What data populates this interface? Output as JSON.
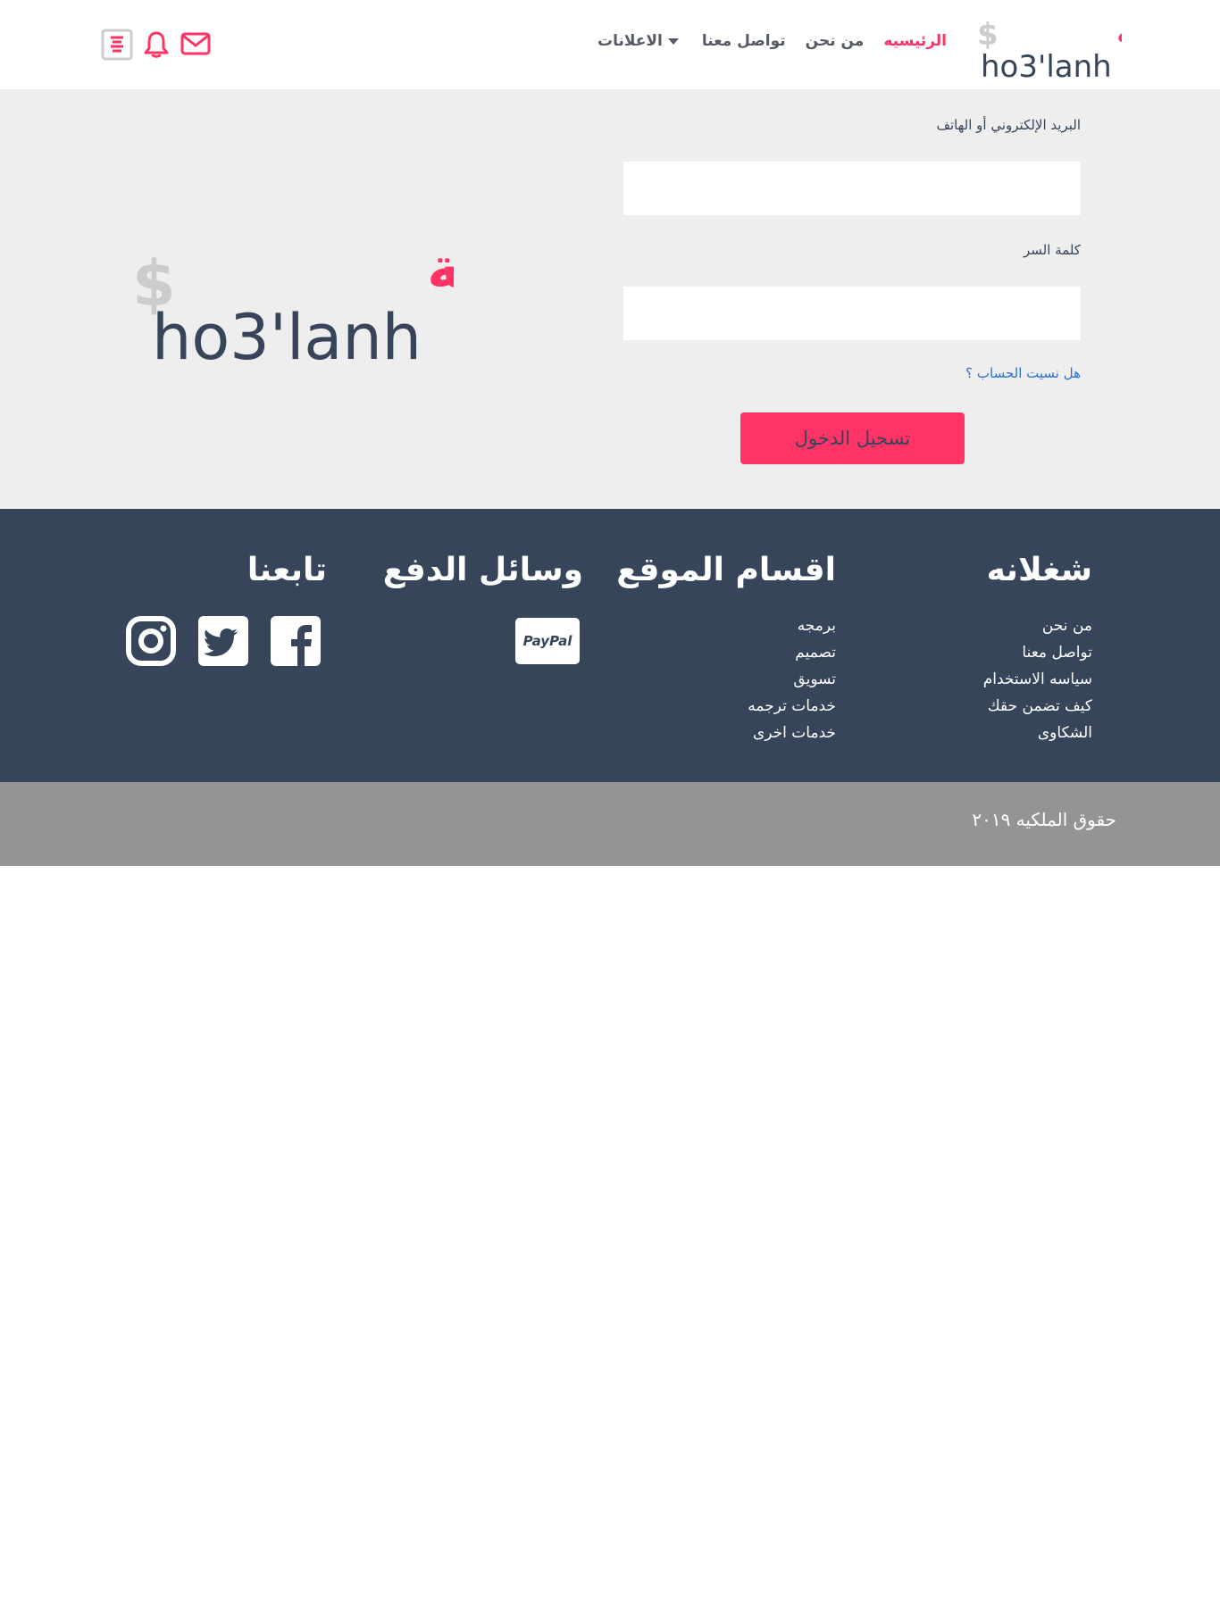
{
  "header": {
    "logo_arabic": "شغلانة",
    "logo_latin": "ho3'lanh",
    "nav": [
      {
        "label": "الرئيسيه",
        "active": true
      },
      {
        "label": "من نحن",
        "active": false
      },
      {
        "label": "تواصل معنا",
        "active": false
      },
      {
        "label": "الاعلانات",
        "active": false,
        "dropdown": true
      }
    ],
    "icons": [
      "mail-icon",
      "bell-icon",
      "menu-icon"
    ]
  },
  "login": {
    "email_label": "البريد الإلكتروني أو الهاتف",
    "email_value": "",
    "password_label": "كلمة السر",
    "password_value": "",
    "forgot_link": "هل نسيت الحساب ؟",
    "submit_label": "تسجيل الدخول"
  },
  "footer": {
    "columns": [
      {
        "title": "شغلانه",
        "links": [
          "من نحن",
          "تواصل معنا",
          "سياسه الاستخدام",
          "كيف تضمن حقك",
          "الشكاوى"
        ]
      },
      {
        "title": "اقسام الموقع",
        "links": [
          "برمجه",
          "تصميم",
          "تسويق",
          "خدمات ترجمه",
          "خدمات اخرى"
        ]
      },
      {
        "title": "وسائل الدفع",
        "payment": "PayPal"
      },
      {
        "title": "تابعنا",
        "social": [
          "facebook-icon",
          "twitter-icon",
          "instagram-icon"
        ]
      }
    ]
  },
  "copyright": "حقوق الملكيه ٢٠١٩",
  "colors": {
    "brand_pink": "#ff3366",
    "navy": "#36455a",
    "light_gray": "#eeeeee",
    "footer_gray": "#959395"
  }
}
